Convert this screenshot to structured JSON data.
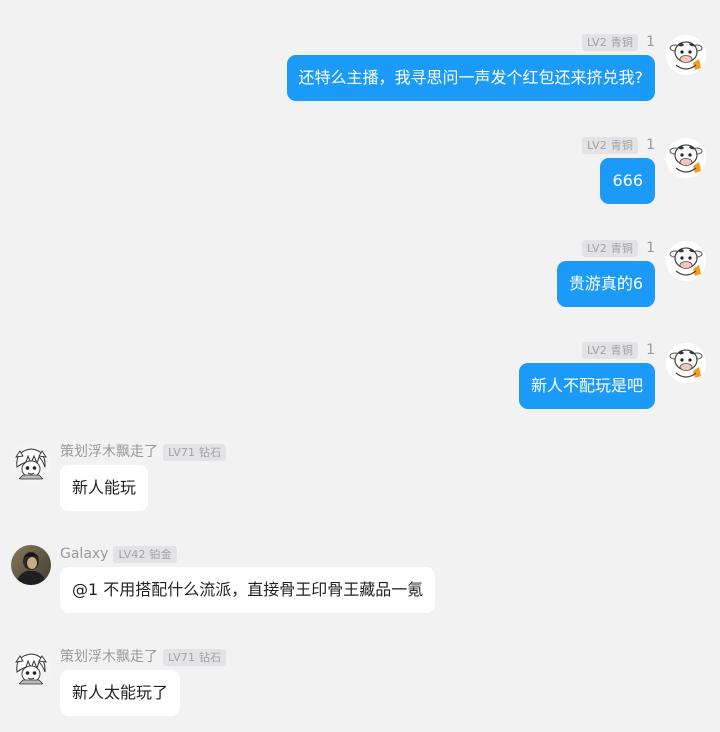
{
  "badge_colors": {
    "background": "#e3e3e5",
    "text": "#a1a1a6"
  },
  "bubble_colors": {
    "outgoing": "#1b9bf7",
    "incoming": "#ffffff"
  },
  "outgoing": [
    {
      "badge": "LV2 青铜",
      "count": "1",
      "text": "还特么主播，我寻思问一声发个红包还来挤兑我?",
      "avatar": "cow-avatar-icon"
    },
    {
      "badge": "LV2 青铜",
      "count": "1",
      "text": "666",
      "avatar": "cow-avatar-icon"
    },
    {
      "badge": "LV2 青铜",
      "count": "1",
      "text": "贵游真的6",
      "avatar": "cow-avatar-icon"
    },
    {
      "badge": "LV2 青铜",
      "count": "1",
      "text": "新人不配玩是吧",
      "avatar": "cow-avatar-icon"
    }
  ],
  "incoming": [
    {
      "name": "策划浮木飘走了",
      "badge": "LV71 钻石",
      "text": "新人能玩",
      "avatar": "anime-girl-avatar-icon"
    },
    {
      "name": "Galaxy",
      "badge": "LV42 铂金",
      "text": "@1 不用搭配什么流派，直接骨王印骨王藏品一氪",
      "avatar": "dark-portrait-avatar-icon"
    },
    {
      "name": "策划浮木飘走了",
      "badge": "LV71 钻石",
      "text": "新人太能玩了",
      "avatar": "anime-girl-avatar-icon"
    }
  ]
}
